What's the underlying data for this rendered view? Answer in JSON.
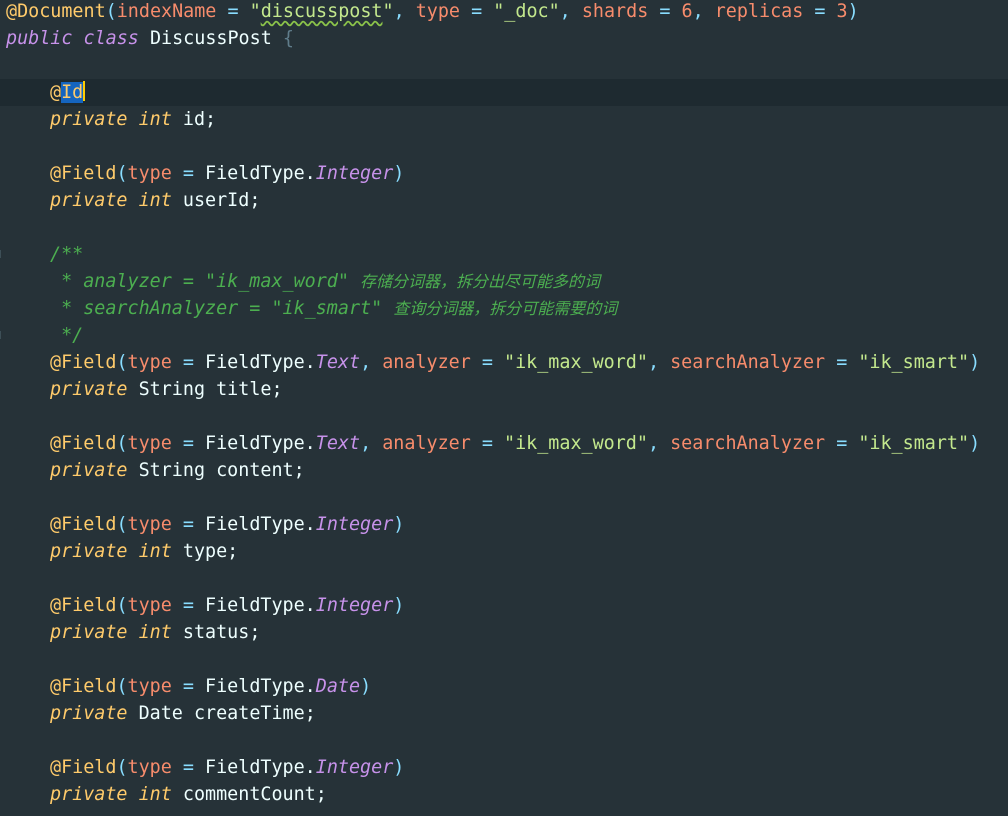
{
  "editor": {
    "lines": {
      "doc_ann": "@Document",
      "doc_open": "(",
      "doc_p1": "indexName",
      "doc_eq1": " = ",
      "doc_v1q": "\"",
      "doc_v1": "discusspost",
      "doc_v1q2": "\"",
      "doc_c1": ", ",
      "doc_p2": "type",
      "doc_eq2": " = ",
      "doc_v2": "\"_doc\"",
      "doc_c2": ", ",
      "doc_p3": "shards",
      "doc_eq3": " = ",
      "doc_v3": "6",
      "doc_c3": ", ",
      "doc_p4": "replicas",
      "doc_eq4": " = ",
      "doc_v4": "3",
      "doc_close": ")",
      "cls_public": "public",
      "cls_class": "class",
      "cls_name": "DiscussPost",
      "cls_brace": "{",
      "id_at": "@",
      "id_name": "Id",
      "f_id_private": "private",
      "f_id_type": "int",
      "f_id_name": "id;",
      "uid_ann": "@Field",
      "uid_open": "(",
      "uid_p": "type",
      "uid_eq": " = ",
      "uid_cls": "FieldType.",
      "uid_val": "Integer",
      "uid_close": ")",
      "f_uid_private": "private",
      "f_uid_type": "int",
      "f_uid_name": "userId;",
      "cm_open": "/**",
      "cm_l1_star": " * ",
      "cm_l1_code": "analyzer = \"ik_max_word\"",
      "cm_l1_text": "存储分词器，拆分出尽可能多的词",
      "cm_l2_star": " * ",
      "cm_l2_code": "searchAnalyzer = \"ik_smart\"",
      "cm_l2_text": "查询分词器，拆分可能需要的词",
      "cm_close": " */",
      "t_ann": "@Field",
      "t_open": "(",
      "t_p1": "type",
      "t_eq1": " = ",
      "t_cls": "FieldType.",
      "t_val": "Text",
      "t_c1": ", ",
      "t_p2": "analyzer",
      "t_eq2": " = ",
      "t_v2": "\"ik_max_word\"",
      "t_c2": ", ",
      "t_p3": "searchAnalyzer",
      "t_eq3": " = ",
      "t_v3": "\"ik_smart\"",
      "t_close": ")",
      "f_title_private": "private",
      "f_title_type": "String",
      "f_title_name": "title;",
      "c_ann": "@Field",
      "c_open": "(",
      "c_p1": "type",
      "c_eq1": " = ",
      "c_cls": "FieldType.",
      "c_val": "Text",
      "c_c1": ", ",
      "c_p2": "analyzer",
      "c_eq2": " = ",
      "c_v2": "\"ik_max_word\"",
      "c_c2": ", ",
      "c_p3": "searchAnalyzer",
      "c_eq3": " = ",
      "c_v3": "\"ik_smart\"",
      "c_close": ")",
      "f_content_private": "private",
      "f_content_type": "String",
      "f_content_name": "content;",
      "ty_ann": "@Field",
      "ty_open": "(",
      "ty_p": "type",
      "ty_eq": " = ",
      "ty_cls": "FieldType.",
      "ty_val": "Integer",
      "ty_close": ")",
      "f_type_private": "private",
      "f_type_type": "int",
      "f_type_name": "type;",
      "st_ann": "@Field",
      "st_open": "(",
      "st_p": "type",
      "st_eq": " = ",
      "st_cls": "FieldType.",
      "st_val": "Integer",
      "st_close": ")",
      "f_status_private": "private",
      "f_status_type": "int",
      "f_status_name": "status;",
      "ct_ann": "@Field",
      "ct_open": "(",
      "ct_p": "type",
      "ct_eq": " = ",
      "ct_cls": "FieldType.",
      "ct_val": "Date",
      "ct_close": ")",
      "f_ct_private": "private",
      "f_ct_type": "Date",
      "f_ct_name": "createTime;",
      "cc_ann": "@Field",
      "cc_open": "(",
      "cc_p": "type",
      "cc_eq": " = ",
      "cc_cls": "FieldType.",
      "cc_val": "Integer",
      "cc_close": ")",
      "f_cc_private": "private",
      "f_cc_type": "int",
      "f_cc_name": "commentCount;"
    }
  }
}
